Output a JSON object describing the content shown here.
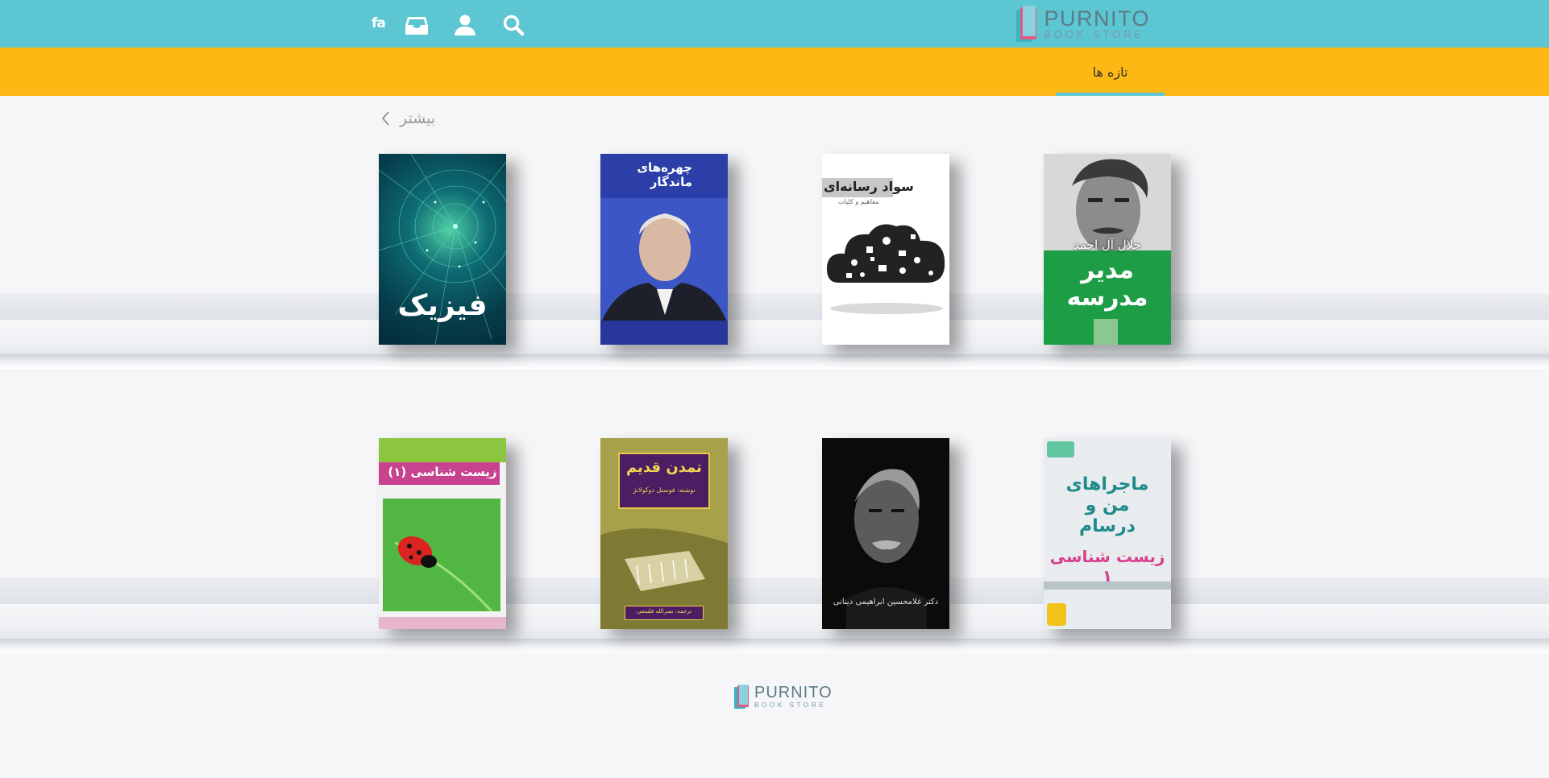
{
  "theme": {
    "teal": "#5cc6d2",
    "yellow": "#fdb813",
    "tab_underline": "#5cc6d2"
  },
  "header": {
    "lang": "fa",
    "icons": [
      "inbox-icon",
      "user-icon",
      "search-icon"
    ],
    "brand": {
      "name": "PURNITO",
      "sub": "BOOK STORE"
    }
  },
  "tabs": [
    {
      "label": "تازه ها",
      "active": true
    }
  ],
  "section": {
    "more_label": "بیشتر"
  },
  "shelves": [
    {
      "books": [
        {
          "cover_text": "فیزیک"
        },
        {
          "cover_text": "چهره‌های ماندگار"
        },
        {
          "cover_text": "سواد رسانه‌ای",
          "cover_sub": "مفاهیم و کلیات"
        },
        {
          "cover_author": "جلال آل احمد",
          "cover_text": "مدیر مدرسه"
        }
      ]
    },
    {
      "books": [
        {
          "cover_text": "زیست شناسی (۱)"
        },
        {
          "cover_text": "تمدن قدیم",
          "cover_sub": "نوشته: فوستل دوکولانژ",
          "cover_bottom": "ترجمه: نصرالله فلسفی"
        },
        {
          "cover_bottom": "دکتر غلامحسین ابراهیمی دینانی"
        },
        {
          "cover_text": "ماجراهای من و درسام",
          "cover_sub": "زیست شناسی ۱"
        }
      ]
    }
  ],
  "footer": {
    "brand": {
      "name": "PURNITO",
      "sub": "BOOK STORE"
    }
  }
}
